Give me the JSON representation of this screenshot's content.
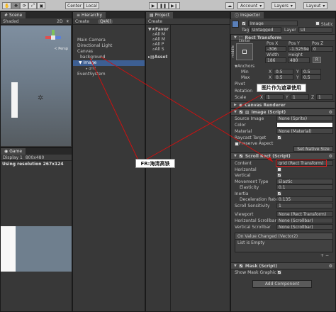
{
  "toolbar": {
    "pivot": "Center",
    "space": "Local",
    "account": "Account",
    "layers": "Layers",
    "layout": "Layout"
  },
  "scene": {
    "tab": "Scene",
    "shading": "Shaded",
    "mode_2d": "2D",
    "persp": "< Persp"
  },
  "game": {
    "tab": "Game",
    "display": "Display 1",
    "resolution": "800x480",
    "status": "Using resolution 267x124"
  },
  "hierarchy": {
    "tab": "Hierarchy",
    "create": "Create",
    "search": "Q▾All",
    "items": [
      "Main Camera",
      "Directional Light",
      "Canvas",
      "background",
      "Image",
      "grid",
      "EventSystem"
    ]
  },
  "project": {
    "tab": "Project",
    "create": "Create",
    "favorites_label": "Favor",
    "favorites": [
      "All M",
      "All M",
      "All P",
      "All S"
    ],
    "assets": "Asset"
  },
  "inspector": {
    "tab": "Inspector",
    "object_name": "Image",
    "static": "Static",
    "tag_label": "Tag",
    "tag": "Untagged",
    "layer_label": "Layer",
    "layer": "UI",
    "rect_transform": {
      "title": "Rect Transform",
      "anchor": "center",
      "middle": "middle",
      "col1": "Pos X",
      "col2": "Pos Y",
      "col3": "Pos Z",
      "posx": "-306",
      "posy": "-1.5259e-",
      "posz": "0",
      "col4": "Width",
      "col5": "Height",
      "width": "186",
      "height": "480",
      "anchors": "Anchors",
      "min_label": "Min",
      "min_x": "0.5",
      "min_y": "0.5",
      "max_label": "Max",
      "max_x": "0.5",
      "max_y": "0.5",
      "pivot_label": "Pivot",
      "rotation_label": "Rotation",
      "scale_label": "Scale",
      "scale_x": "1",
      "scale_y": "1",
      "scale_z": "1"
    },
    "canvas_renderer": "Canvas Renderer",
    "image": {
      "title": "Image (Script)",
      "source_label": "Source Image",
      "source": "None (Sprite)",
      "color_label": "Color",
      "material_label": "Material",
      "material": "None (Material)",
      "raycast_label": "Raycast Target",
      "preserve_label": "Preserve Aspect",
      "native_btn": "Set Native Size"
    },
    "scroll": {
      "title": "Scroll Rect (Script)",
      "content_label": "Content",
      "content": "grid (Rect Transform)",
      "horizontal_label": "Horizontal",
      "vertical_label": "Vertical",
      "movement_label": "Movement Type",
      "movement": "Elastic",
      "elasticity_label": "Elasticity",
      "elasticity": "0.1",
      "inertia_label": "Inertia",
      "decel_label": "Deceleration Rate",
      "decel": "0.135",
      "sensitivity_label": "Scroll Sensitivity",
      "sensitivity": "1",
      "viewport_label": "Viewport",
      "viewport": "None (Rect Transform)",
      "hscroll_label": "Horizontal Scrollbar",
      "hscroll": "None (Scrollbar)",
      "vscroll_label": "Vertical Scrollbar",
      "vscroll": "None (Scrollbar)",
      "event_title": "On Value Changed (Vector2)",
      "event_empty": "List is Empty"
    },
    "mask": {
      "title": "Mask (Script)",
      "show_label": "Show Mask Graphic"
    },
    "add_component": "Add Component"
  },
  "annotations": {
    "top": "图片作为遮罩使用",
    "bottom": "FR:海清高铁"
  },
  "colors": {
    "selection": "#3d5f93",
    "annotation_line": "#cc1111"
  }
}
